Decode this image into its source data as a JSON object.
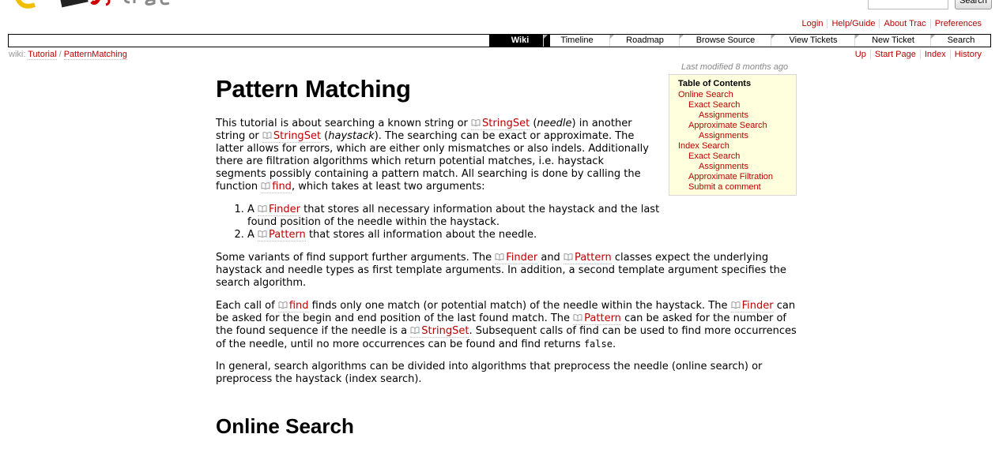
{
  "header": {
    "search_button": "Search",
    "metanav": [
      "Login",
      "Help/Guide",
      "About Trac",
      "Preferences"
    ]
  },
  "mainnav": {
    "tabs": [
      "Wiki",
      "Timeline",
      "Roadmap",
      "Browse Source",
      "View Tickets",
      "New Ticket",
      "Search"
    ],
    "active": "Wiki"
  },
  "breadcrumb": {
    "prefix": "wiki:",
    "items": [
      "Tutorial",
      "PatternMatching"
    ],
    "separator": "/"
  },
  "ctxtnav": [
    "Up",
    "Start Page",
    "Index",
    "History"
  ],
  "last_modified": {
    "label": "Last modified",
    "value": "8 months ago"
  },
  "toc": {
    "title": "Table of Contents",
    "entries": [
      {
        "label": "Online Search",
        "level": 1
      },
      {
        "label": "Exact Search",
        "level": 2
      },
      {
        "label": "Assignments",
        "level": 3
      },
      {
        "label": "Approximate Search",
        "level": 2
      },
      {
        "label": "Assignments",
        "level": 3
      },
      {
        "label": "Index Search",
        "level": 1
      },
      {
        "label": "Exact Search",
        "level": 2
      },
      {
        "label": "Assignments",
        "level": 3
      },
      {
        "label": "Approximate Filtration",
        "level": 2
      },
      {
        "label": "Submit a comment",
        "level": 2
      }
    ]
  },
  "content": {
    "title": "Pattern Matching",
    "links": {
      "stringset": "StringSet",
      "find": "find",
      "finder": "Finder",
      "pattern": "Pattern"
    },
    "p1": {
      "t1": "This tutorial is about searching a known string or ",
      "needle": "needle",
      "t2": ") in another string or ",
      "haystack": "haystack",
      "t3": "). The searching can be exact or approximate. The latter allows for errors, which are either only mismatches or also indels. Additionally there are filtration algorithms which return potential matches, i.e. haystack segments possibly containing a pattern match. All searching is done by calling the function ",
      "t4": ", which takes at least two arguments:"
    },
    "list": [
      {
        "pre": "A ",
        "post": " that stores all necessary information about the haystack and the last found position of the needle within the haystack."
      },
      {
        "pre": "A ",
        "post": " that stores all information about the needle."
      }
    ],
    "p2": {
      "t1": "Some variants of find support further arguments. The ",
      "and": " and ",
      "t2": " classes expect the underlying haystack and needle types as first template arguments. In addition, a second template argument specifies the search algorithm."
    },
    "p3": {
      "t1": "Each call of ",
      "t2": " finds only one match (or potential match) of the needle within the haystack. The ",
      "t3": " can be asked for the begin and end position of the last found match. The ",
      "t4": " can be asked for the number of the found sequence if the needle is a ",
      "t5": ". Subsequent calls of find can be used to find more occurrences of the needle, until no more occurrences can be found and find returns ",
      "code": "false",
      "t6": "."
    },
    "p4": "In general, search algorithms can be divided into algorithms that preprocess the needle (online search) or preprocess the haystack (index search).",
    "section_heading": "Online Search"
  }
}
